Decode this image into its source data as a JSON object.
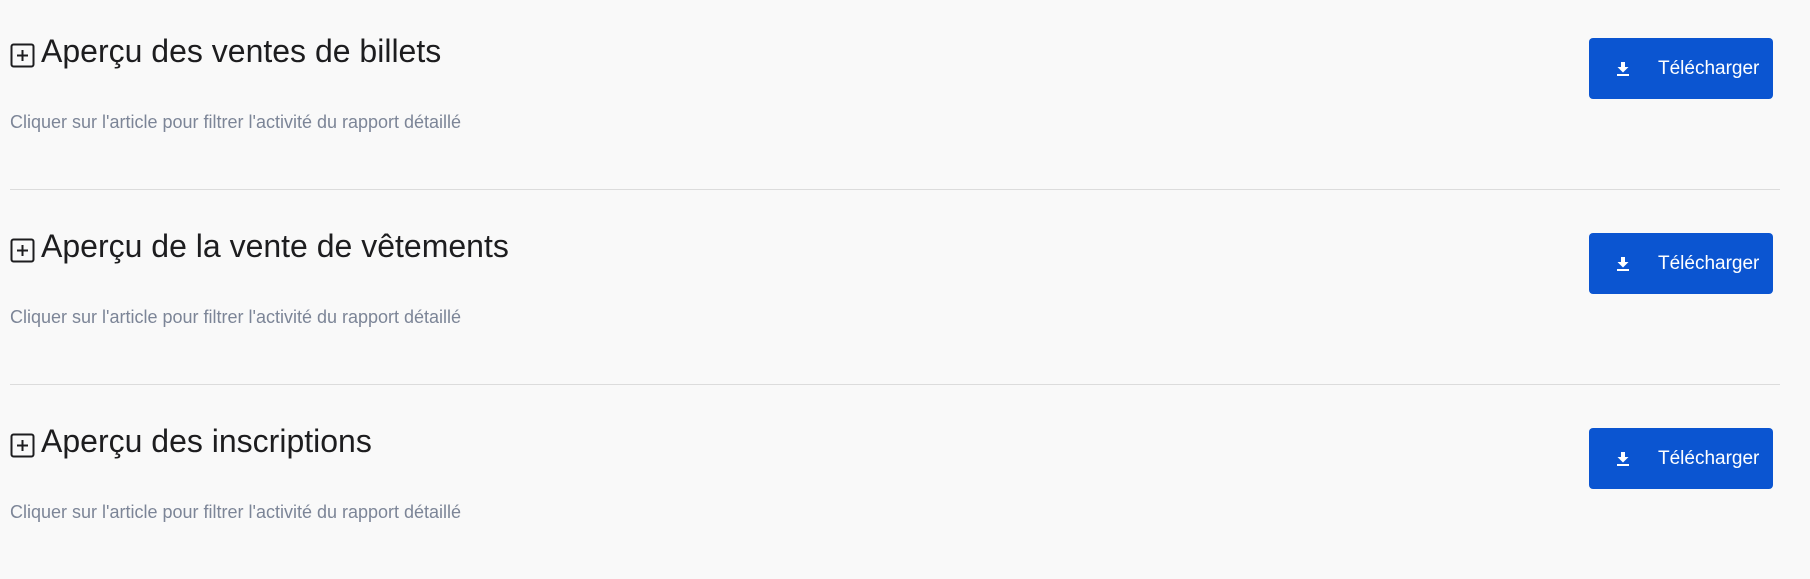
{
  "sections": [
    {
      "title": "Aperçu des ventes de billets",
      "subtitle": "Cliquer sur l'article pour filtrer l'activité du rapport détaillé",
      "button_label": "Télécharger"
    },
    {
      "title": "Aperçu de la vente de vêtements",
      "subtitle": "Cliquer sur l'article pour filtrer l'activité du rapport détaillé",
      "button_label": "Télécharger"
    },
    {
      "title": "Aperçu des inscriptions",
      "subtitle": "Cliquer sur l'article pour filtrer l'activité du rapport détaillé",
      "button_label": "Télécharger"
    }
  ],
  "icons": {
    "expand": "plus-square-icon",
    "download": "download-icon"
  },
  "colors": {
    "button_background": "#0b55d1",
    "title_text": "#1d1d1f",
    "subtitle_text": "#7c8597",
    "divider": "#dcdcdc",
    "page_background": "#f9f9f9"
  }
}
